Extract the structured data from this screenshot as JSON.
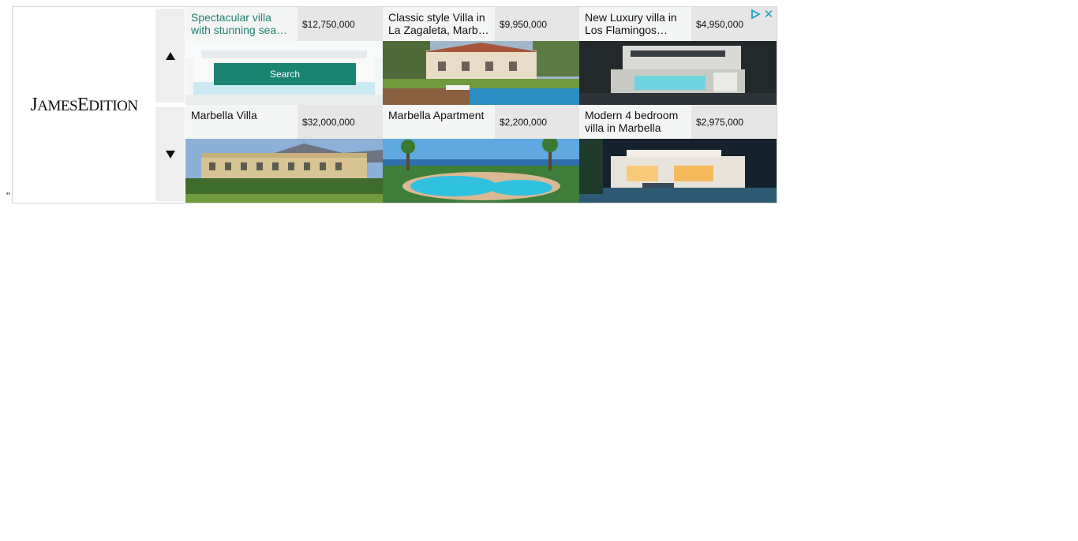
{
  "stray_text": "\"",
  "brand": {
    "logo_text": "JamesEdition"
  },
  "nav": {
    "up_label": "▲",
    "down_label": "▼"
  },
  "ad_controls": {
    "adchoices_icon": "adchoices-icon",
    "close_icon": "close-icon",
    "accent": "#1aa0c7"
  },
  "search": {
    "label": "Search"
  },
  "listings": [
    {
      "title": "Spectacular villa with stunning sea…",
      "price": "$12,750,000"
    },
    {
      "title": "Classic style Villa in La Zagaleta, Marb…",
      "price": "$9,950,000"
    },
    {
      "title": "New Luxury villa in Los Flamingos Gol…",
      "price": "$4,950,000"
    },
    {
      "title": "Marbella Villa",
      "price": "$32,000,000"
    },
    {
      "title": "Marbella Apartment",
      "price": "$2,200,000"
    },
    {
      "title": "Modern 4 bedroom villa in Marbella",
      "price": "$2,975,000"
    }
  ],
  "colors": {
    "brand_green": "#1a8472",
    "title_active": "#1f7f70",
    "price_bg": "#e6e6e6",
    "title_bg": "#f4f5f5"
  }
}
